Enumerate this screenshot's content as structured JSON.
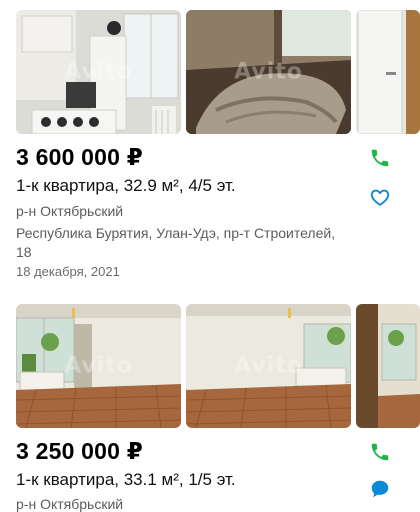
{
  "watermark": "Avito",
  "colors": {
    "accent_green": "#1fb54a",
    "accent_blue": "#0a8ad6",
    "text_secondary": "#5c5c5c"
  },
  "listings": [
    {
      "price": "3 600 000 ₽",
      "title": "1-к квартира, 32.9 м², 4/5 эт.",
      "district": "р-н Октябрьский",
      "address": "Республика Бурятия, Улан-Удэ, пр-т Строителей, 18",
      "date": "18 декабря, 2021",
      "icons": [
        "phone-icon",
        "heart-icon"
      ]
    },
    {
      "price": "3 250 000 ₽",
      "title": "1-к квартира, 33.1 м², 1/5 эт.",
      "district": "р-н Октябрьский",
      "icons": [
        "phone-icon",
        "chat-icon"
      ]
    }
  ]
}
